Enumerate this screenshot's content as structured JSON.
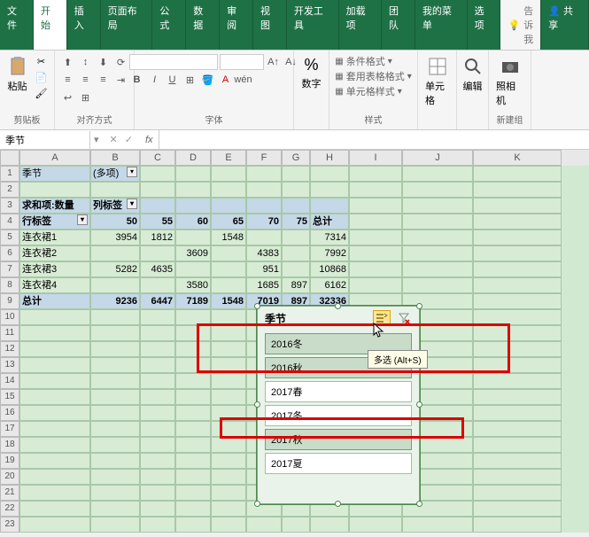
{
  "tabs": {
    "file": "文件",
    "home": "开始",
    "insert": "插入",
    "layout": "页面布局",
    "formulas": "公式",
    "data": "数据",
    "review": "审阅",
    "view": "视图",
    "dev": "开发工具",
    "addins": "加载项",
    "team": "团队",
    "my": "我的菜单",
    "options": "选项",
    "tell": "告诉我",
    "share": "共享"
  },
  "ribbon": {
    "clipboard": "剪贴板",
    "paste": "粘贴",
    "align": "对齐方式",
    "font": "字体",
    "number": "数字",
    "styles": "样式",
    "cond_fmt": "条件格式",
    "table_fmt": "套用表格格式",
    "cell_fmt": "单元格样式",
    "cells": "单元格",
    "editing": "编辑",
    "camera": "照相机",
    "newgroup": "新建组"
  },
  "namebox": {
    "name": "季节",
    "fx": "fx"
  },
  "cols": [
    "A",
    "B",
    "C",
    "D",
    "E",
    "F",
    "G",
    "H",
    "I",
    "J",
    "K"
  ],
  "pivot": {
    "page_field": "季节",
    "page_value": "(多项)",
    "data_label": "求和项:数量",
    "col_header": "列标签",
    "row_header": "行标签",
    "total": "总计",
    "col_values": [
      "50",
      "55",
      "60",
      "65",
      "70",
      "75"
    ],
    "rows": [
      {
        "label": "连衣裙1",
        "v": [
          "3954",
          "1812",
          "",
          "1548",
          "",
          "",
          ""
        ],
        "t": "7314"
      },
      {
        "label": "连衣裙2",
        "v": [
          "",
          "",
          "3609",
          "",
          "4383",
          "",
          ""
        ],
        "t": "7992"
      },
      {
        "label": "连衣裙3",
        "v": [
          "5282",
          "4635",
          "",
          "",
          "951",
          "",
          ""
        ],
        "t": "10868"
      },
      {
        "label": "连衣裙4",
        "v": [
          "",
          "",
          "3580",
          "",
          "1685",
          "897",
          ""
        ],
        "t": "6162"
      }
    ],
    "grand": {
      "label": "总计",
      "v": [
        "9236",
        "6447",
        "7189",
        "1548",
        "7019",
        "897"
      ],
      "t": "32336"
    }
  },
  "chart_data": {
    "type": "table",
    "title": "求和项:数量",
    "row_field": "行标签",
    "col_field": "列标签",
    "columns": [
      50,
      55,
      60,
      65,
      70,
      75
    ],
    "rows": [
      "连衣裙1",
      "连衣裙2",
      "连衣裙3",
      "连衣裙4"
    ],
    "values": [
      [
        3954,
        1812,
        null,
        1548,
        null,
        null
      ],
      [
        null,
        null,
        3609,
        null,
        4383,
        null
      ],
      [
        5282,
        4635,
        null,
        null,
        951,
        null
      ],
      [
        null,
        null,
        3580,
        null,
        1685,
        897
      ]
    ],
    "row_totals": [
      7314,
      7992,
      10868,
      6162
    ],
    "col_totals": [
      9236,
      6447,
      7189,
      1548,
      7019,
      897
    ],
    "grand_total": 32336
  },
  "slicer": {
    "title": "季节",
    "items": [
      {
        "label": "2016冬",
        "selected": true
      },
      {
        "label": "2016秋",
        "selected": true
      },
      {
        "label": "2017春",
        "selected": false
      },
      {
        "label": "2017冬",
        "selected": false
      },
      {
        "label": "2017秋",
        "selected": true
      },
      {
        "label": "2017夏",
        "selected": false
      }
    ],
    "tooltip": "多选 (Alt+S)"
  }
}
